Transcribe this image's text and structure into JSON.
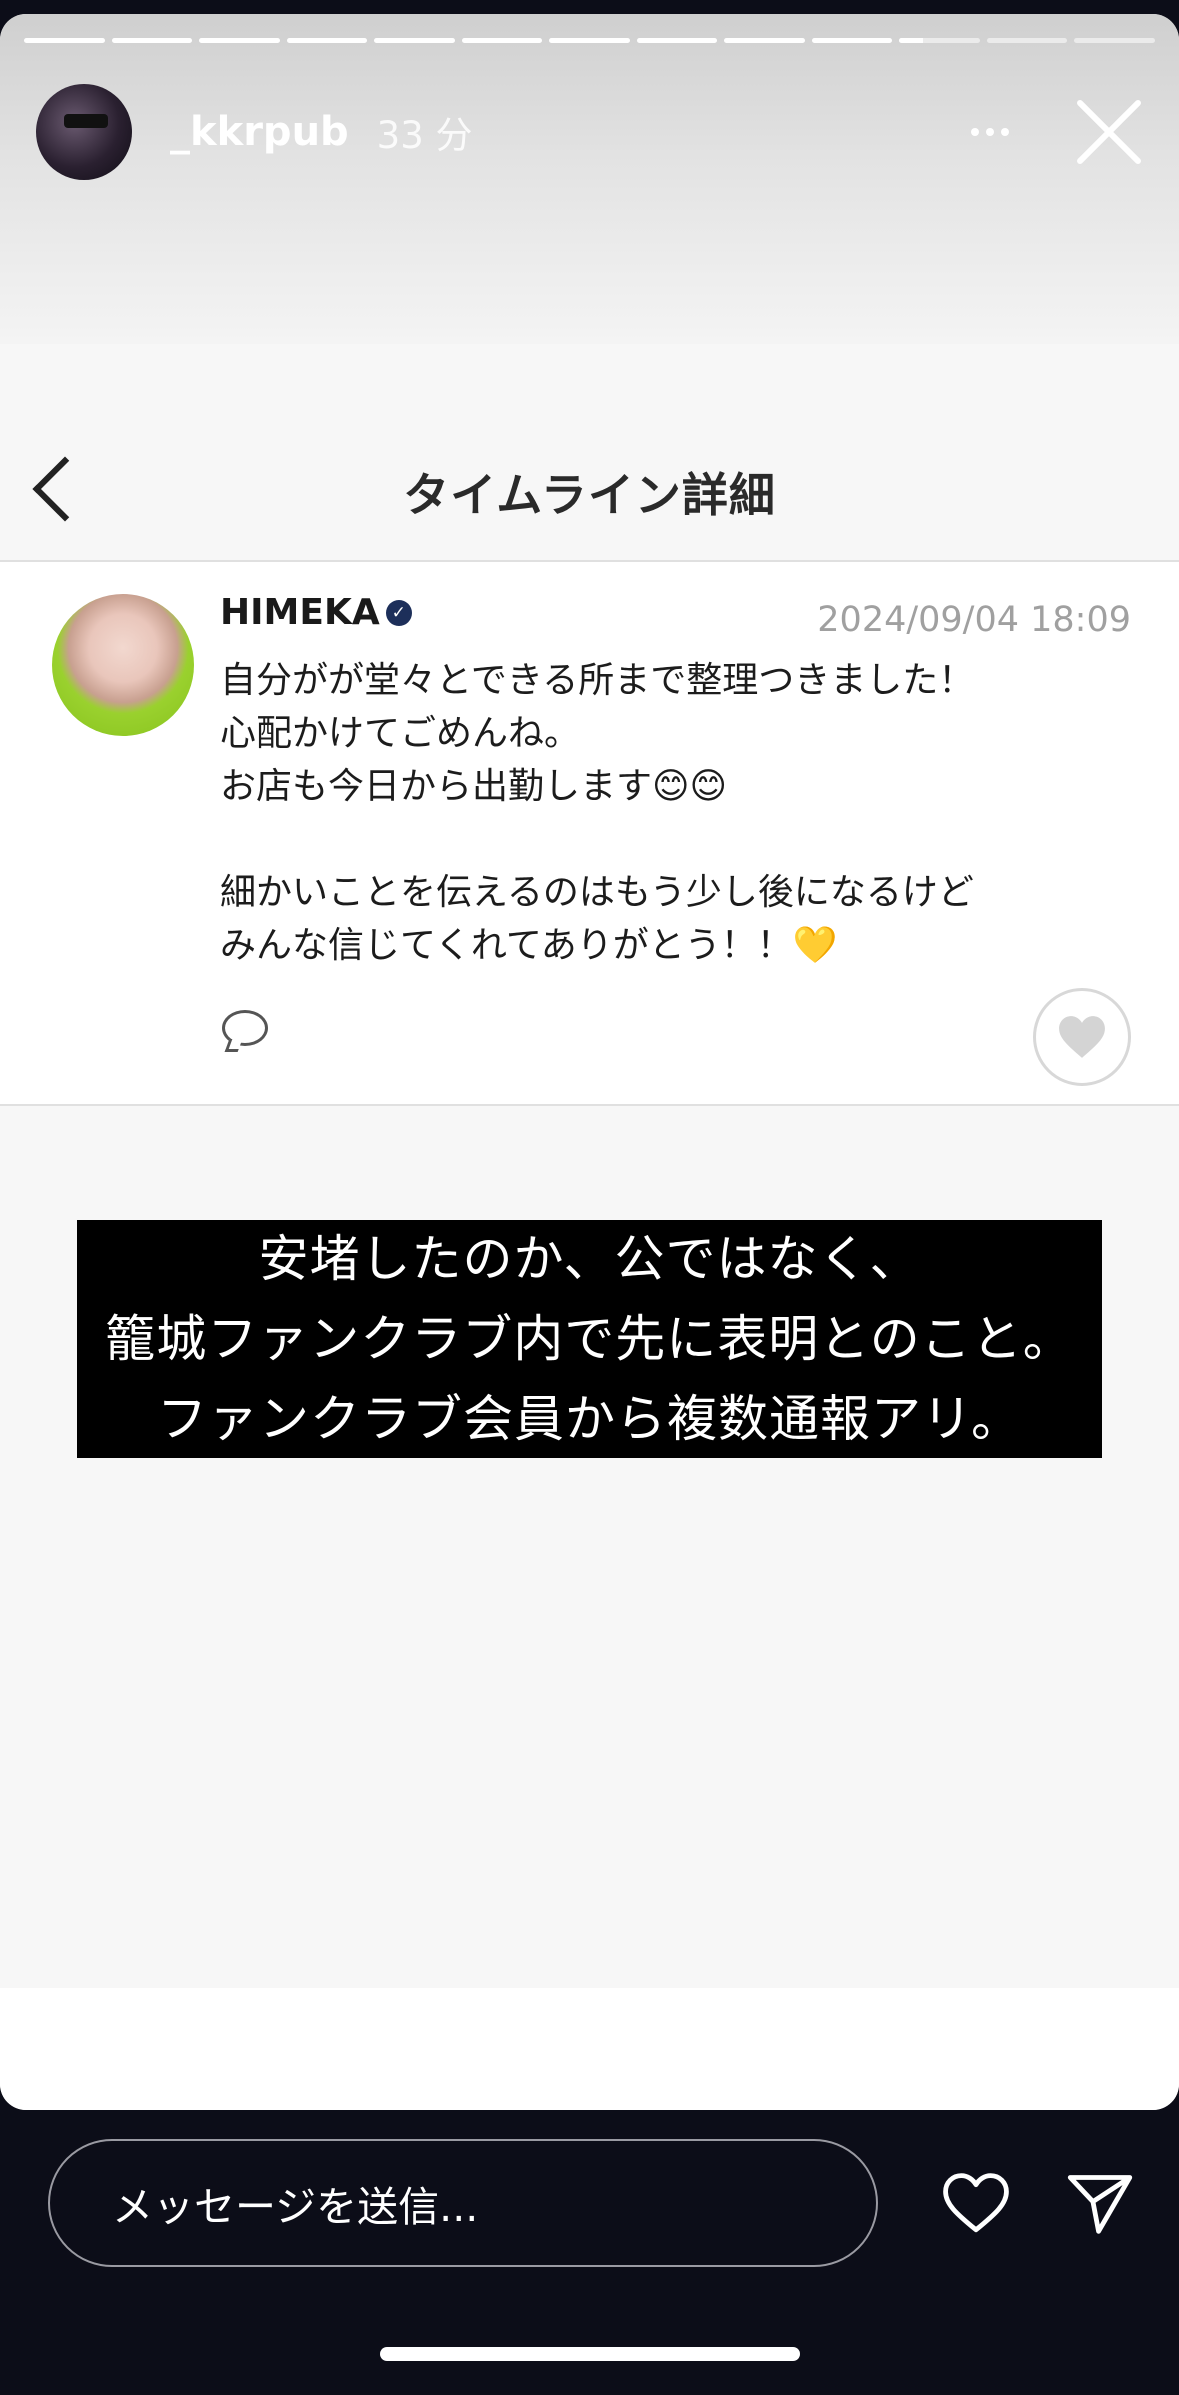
{
  "story": {
    "username": "_kkrpub",
    "time_ago": "33 分",
    "progress": {
      "total_segments": 13,
      "completed_segments": 10,
      "current_segment_fraction": 0.3
    }
  },
  "page": {
    "title": "タイムライン詳細"
  },
  "post": {
    "author": "HIMEKA",
    "date": "2024/09/04 18:09",
    "body": "自分がが堂々とできる所まで整理つきました！\n心配かけてごめんね。\nお店も今日から出勤します😊😊\n\n細かいことを伝えるのはもう少し後になるけど\nみんな信じてくれてありがとう！！💛"
  },
  "caption": {
    "lines": [
      "安堵したのか、公ではなく、",
      "籠城ファンクラブ内で先に表明とのこと。",
      "ファンクラブ会員から複数通報アリ。"
    ]
  },
  "message_bar": {
    "placeholder": "メッセージを送信..."
  },
  "icons": {
    "verified": "verified-check-icon",
    "comment": "comment-bubble-icon",
    "like": "heart-icon",
    "send": "paper-plane-icon",
    "close": "close-icon",
    "more": "more-dots-icon",
    "back": "chevron-left-icon"
  },
  "colors": {
    "background": "#0c0d18",
    "caption_bg": "#000000",
    "verified": "#1d2f5a"
  }
}
